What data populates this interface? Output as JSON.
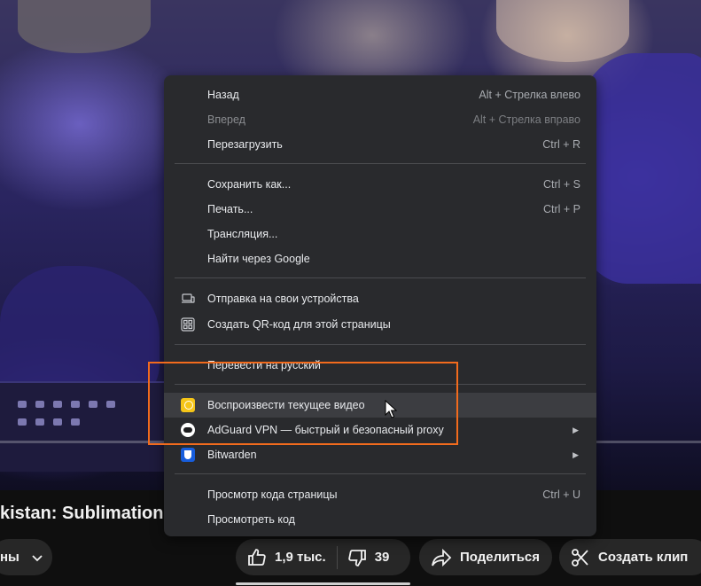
{
  "video": {
    "title": "kistan: Sublimation"
  },
  "actions": {
    "subscribe_partial": "ны",
    "like_count": "1,9 тыс.",
    "dislike_count": "39",
    "share_label": "Поделиться",
    "clip_label": "Создать клип"
  },
  "context_menu": {
    "back": {
      "label": "Назад",
      "shortcut": "Alt + Стрелка влево"
    },
    "forward": {
      "label": "Вперед",
      "shortcut": "Alt + Стрелка вправо"
    },
    "reload": {
      "label": "Перезагрузить",
      "shortcut": "Ctrl + R"
    },
    "save_as": {
      "label": "Сохранить как...",
      "shortcut": "Ctrl + S"
    },
    "print": {
      "label": "Печать...",
      "shortcut": "Ctrl + P"
    },
    "cast": {
      "label": "Трансляция..."
    },
    "google_search": {
      "label": "Найти через Google"
    },
    "send_to_devices": {
      "label": "Отправка на свои устройства"
    },
    "qr_code": {
      "label": "Создать QR-код для этой страницы"
    },
    "translate": {
      "label": "Перевести на русский"
    },
    "play_video": {
      "label": "Воспроизвести текущее видео"
    },
    "adguard_vpn": {
      "label": "AdGuard VPN — быстрый и безопасный proxy"
    },
    "bitwarden": {
      "label": "Bitwarden"
    },
    "view_source": {
      "label": "Просмотр кода страницы",
      "shortcut": "Ctrl + U"
    },
    "inspect": {
      "label": "Просмотреть код"
    }
  },
  "colors": {
    "menu_bg": "#292a2d",
    "annotation": "#f26b1d",
    "play_icon": "#f5c518",
    "bitwarden": "#175ddc"
  }
}
